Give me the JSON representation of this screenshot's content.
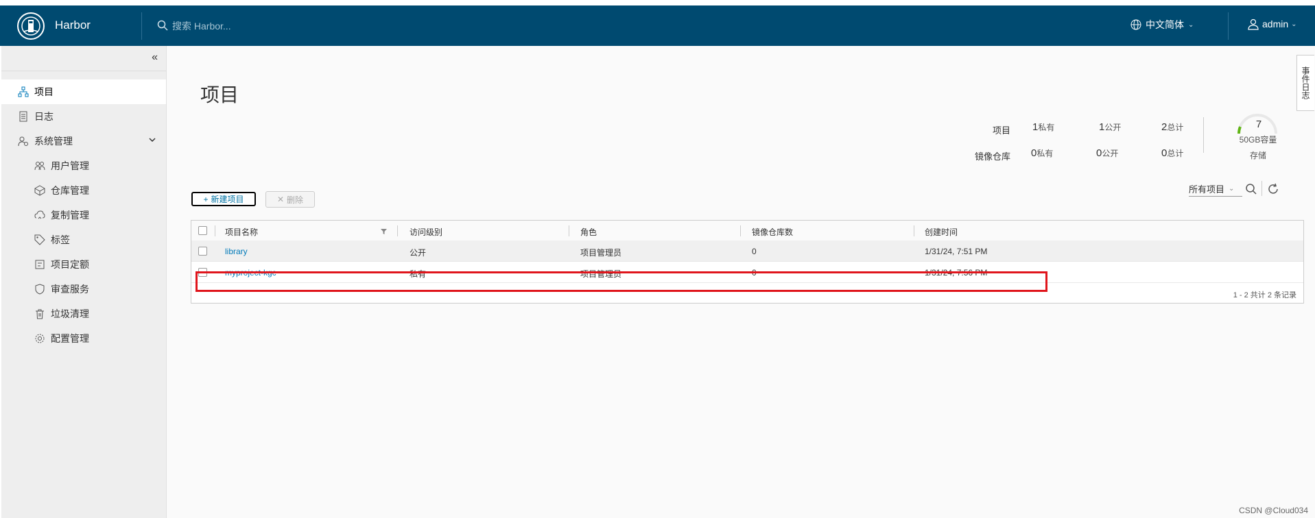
{
  "header": {
    "brand": "Harbor",
    "search_placeholder": "搜索 Harbor...",
    "language": "中文简体",
    "user": "admin"
  },
  "sidebar": {
    "items": [
      {
        "label": "项目",
        "icon": "project-icon",
        "active": true
      },
      {
        "label": "日志",
        "icon": "log-icon"
      },
      {
        "label": "系统管理",
        "icon": "admin-icon"
      },
      {
        "label": "用户管理",
        "icon": "users-icon"
      },
      {
        "label": "仓库管理",
        "icon": "registry-icon"
      },
      {
        "label": "复制管理",
        "icon": "replication-icon"
      },
      {
        "label": "标签",
        "icon": "tag-icon"
      },
      {
        "label": "项目定额",
        "icon": "quota-icon"
      },
      {
        "label": "审查服务",
        "icon": "shield-icon"
      },
      {
        "label": "垃圾清理",
        "icon": "trash-icon"
      },
      {
        "label": "配置管理",
        "icon": "gear-icon"
      }
    ]
  },
  "main": {
    "title": "项目",
    "stats": {
      "projects_label": "项目",
      "repos_label": "镜像仓库",
      "projects": [
        {
          "num": "1",
          "unit": "私有"
        },
        {
          "num": "1",
          "unit": "公开"
        },
        {
          "num": "2",
          "unit": "总计"
        }
      ],
      "repos": [
        {
          "num": "0",
          "unit": "私有"
        },
        {
          "num": "0",
          "unit": "公开"
        },
        {
          "num": "0",
          "unit": "总计"
        }
      ],
      "quota_value": "7",
      "quota_caption": "50GB容量",
      "storage_label": "存储"
    },
    "new_project_label": "新建项目",
    "delete_label": "删除",
    "filter_value": "所有项目",
    "columns": [
      "项目名称",
      "访问级别",
      "角色",
      "镜像仓库数",
      "创建时间"
    ],
    "rows": [
      {
        "name": "library",
        "access": "公开",
        "role": "项目管理员",
        "repos": "0",
        "created": "1/31/24, 7:51 PM"
      },
      {
        "name": "myproject-kgc",
        "access": "私有",
        "role": "项目管理员",
        "repos": "0",
        "created": "1/31/24, 7:56 PM"
      }
    ],
    "footer": "1 - 2 共计 2 条记录"
  },
  "side_tab": "事件日志",
  "watermark": "CSDN @Cloud034",
  "colors": {
    "header": "#004a70",
    "link": "#0079b8",
    "highlight": "#e0151c"
  }
}
